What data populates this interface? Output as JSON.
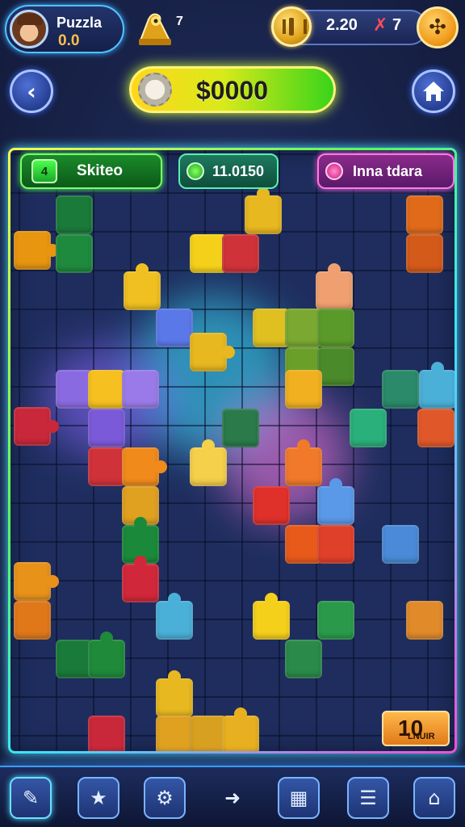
{
  "player": {
    "name": "Puzzla",
    "score": "0.0"
  },
  "trophy": {
    "count": "7"
  },
  "currency": {
    "value": "2.20",
    "lives": "7"
  },
  "header": {
    "score": "$0000"
  },
  "board": {
    "chips": {
      "skill_count": "4",
      "skill_label": "Skiteo",
      "time_label": "11.0150",
      "goal_label": "Inna tdara"
    },
    "level": {
      "number": "10",
      "sub": "LNUIR"
    }
  },
  "icons": {
    "back": "back-arrow-icon",
    "home": "home-icon",
    "settings": "puzzle-gear-icon",
    "coin": "coin-icon",
    "trophy": "puzzle-trophy-icon"
  },
  "colors": {
    "accent_green": "#39d41a",
    "accent_yellow": "#ffd71a",
    "accent_cyan": "#3ae4ff",
    "accent_magenta": "#ff4ad8",
    "board_bg": "#1e2d5e"
  }
}
